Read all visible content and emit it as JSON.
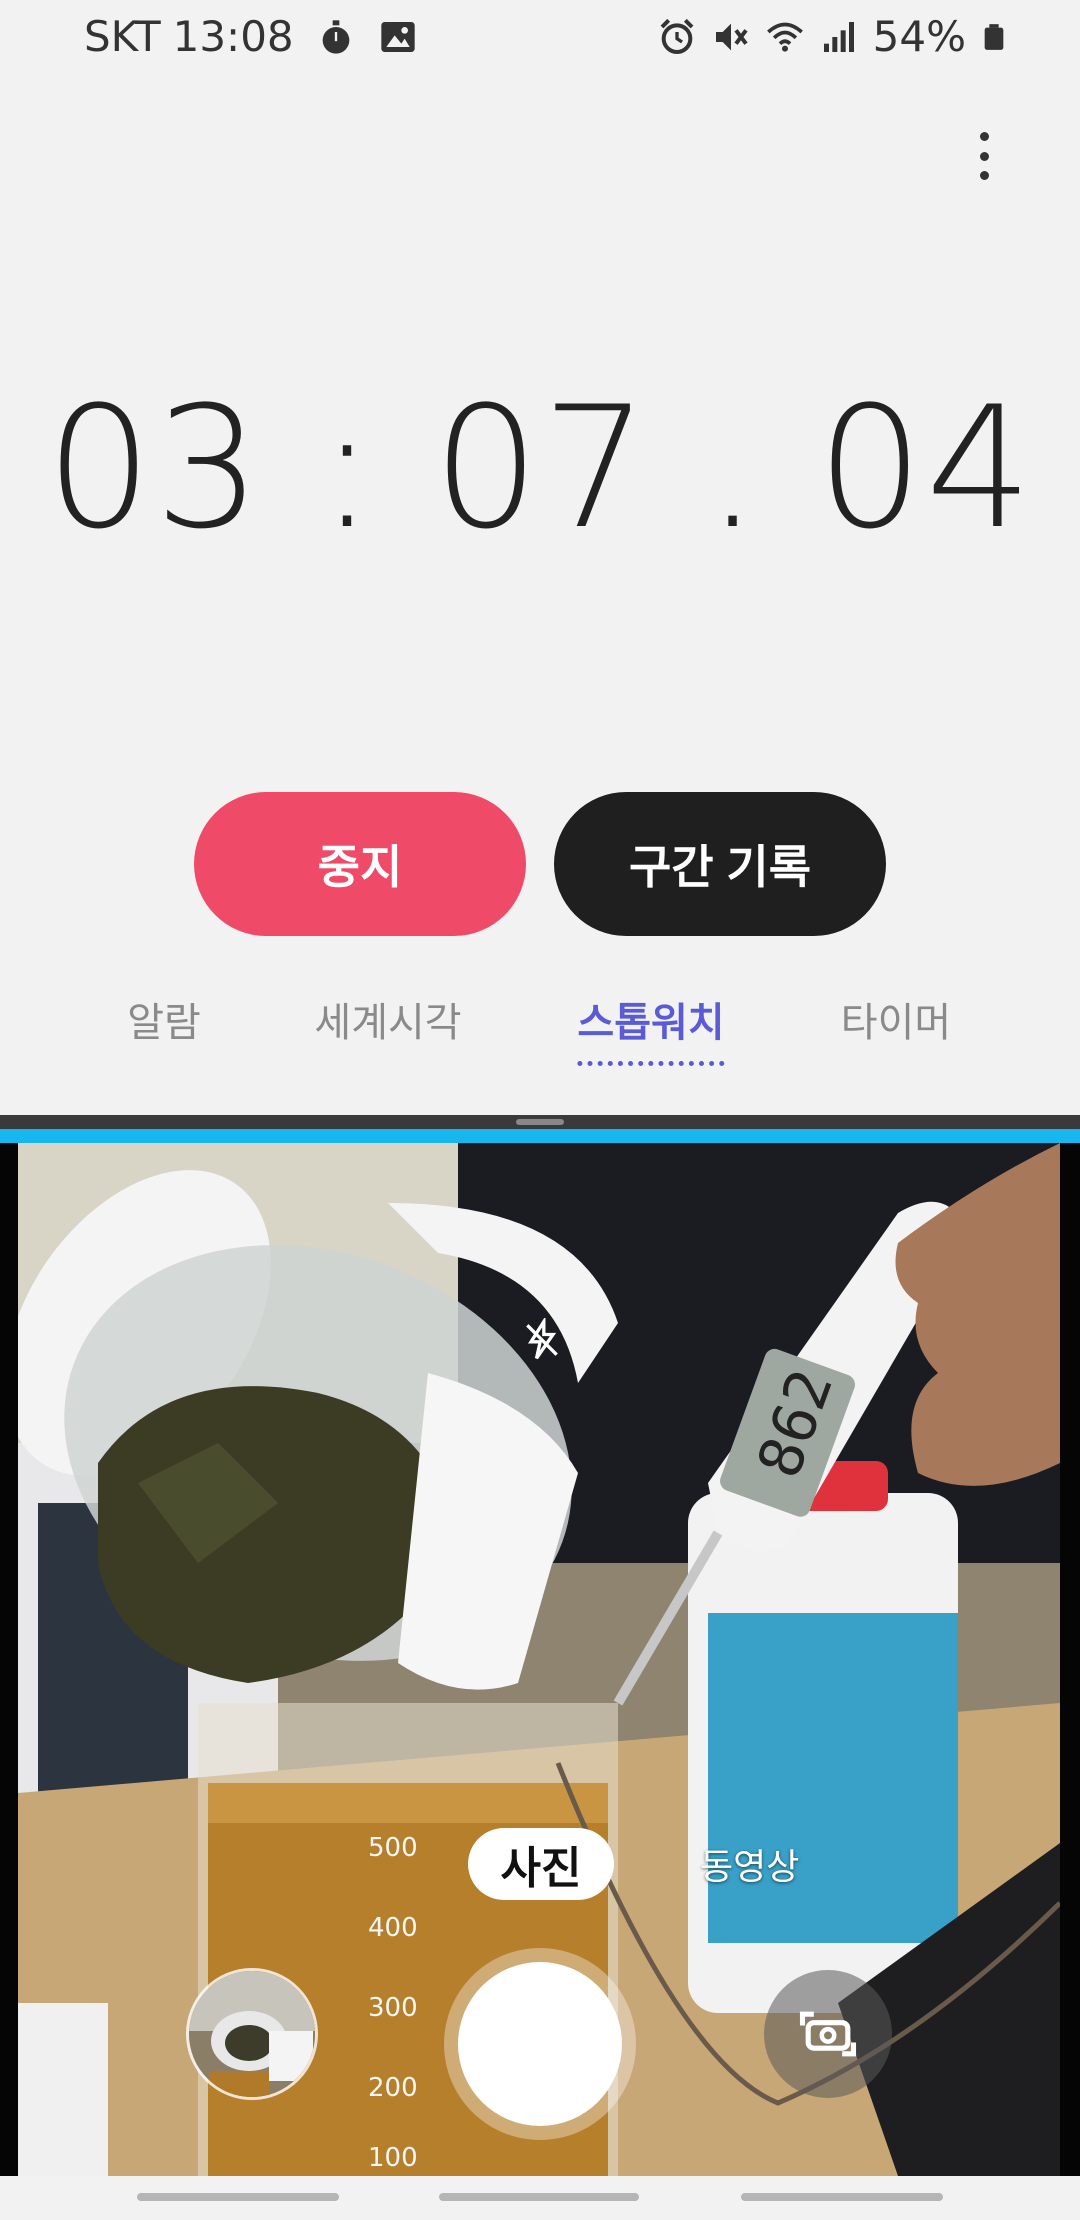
{
  "status_bar": {
    "carrier": "SKT",
    "time": "13:08",
    "battery": "54%",
    "icons_left": [
      "stopwatch-icon",
      "gallery-icon"
    ],
    "icons_right": [
      "alarm-icon",
      "vibrate-mute-icon",
      "wifi-icon",
      "signal-icon",
      "battery-icon"
    ]
  },
  "clock_app": {
    "elapsed": "03 : 07 . 04",
    "stop_label": "중지",
    "lap_label": "구간 기록",
    "tabs": [
      {
        "label": "알람",
        "active": false
      },
      {
        "label": "세계시각",
        "active": false
      },
      {
        "label": "스톱워치",
        "active": true
      },
      {
        "label": "타이머",
        "active": false
      }
    ],
    "accent_color": "#5b5bd6",
    "stop_color": "#ef4a67"
  },
  "camera_app": {
    "mode_photo": "사진",
    "mode_video": "동영상",
    "flash": "flash-off-icon",
    "switch_icon": "switch-camera-icon"
  }
}
